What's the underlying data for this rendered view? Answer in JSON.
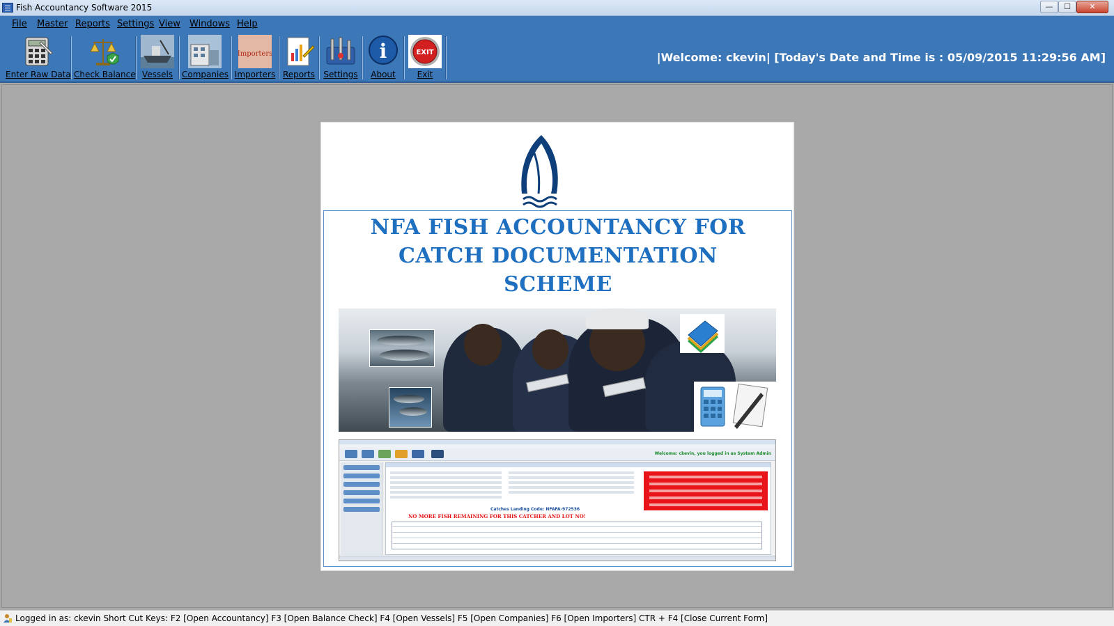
{
  "window": {
    "title": "Fish Accountancy Software 2015",
    "controls": {
      "minimize": "—",
      "maximize": "☐",
      "close": "✕"
    }
  },
  "menu": [
    "File",
    "Master",
    "Reports",
    "Settings",
    "View",
    "Windows",
    "Help"
  ],
  "toolbar": {
    "items": [
      {
        "label": "Enter Raw Data",
        "icon": "calculator-icon"
      },
      {
        "label": "Check Balance",
        "icon": "scales-icon"
      },
      {
        "label": "Vessels",
        "icon": "vessel-icon"
      },
      {
        "label": "Companies",
        "icon": "building-icon"
      },
      {
        "label": "Importers",
        "icon": "importers-icon"
      },
      {
        "label": "Reports",
        "icon": "report-icon"
      },
      {
        "label": "Settings",
        "icon": "settings-icon"
      },
      {
        "label": "About",
        "icon": "info-icon"
      },
      {
        "label": "Exit",
        "icon": "exit-icon"
      }
    ],
    "importers_icon_text": "Importers",
    "exit_icon_text": "EXIT",
    "about_icon_text": "i"
  },
  "welcome": "|Welcome:  ckevin|  [Today's Date and Time is : 05/09/2015 11:29:56 AM]",
  "splash": {
    "headline_lines": [
      "NFA FISH ACCOUNTANCY FOR",
      "CATCH DOCUMENTATION",
      "SCHEME"
    ],
    "mini_screenshot": {
      "welcome": "Welcome: ckevin, you logged in as System Admin",
      "catch_code": "Catches Landing Code:  NFAFA-972536",
      "alert": "NO MORE FISH REMAINING FOR THIS CATCHER AND LOT NO!"
    }
  },
  "status": {
    "text": "Logged in as:  ckevin   Short Cut Keys:  F2 [Open Accountancy]   F3 [Open Balance Check]   F4 [Open Vessels]   F5 [Open Companies]   F6 [Open Importers]   CTR + F4 [Close Current Form]"
  },
  "colors": {
    "toolbar_bg": "#3c78b8",
    "workspace_bg": "#a9a9a9",
    "headline": "#1e6fbf",
    "alert_red": "#e41b1b"
  }
}
